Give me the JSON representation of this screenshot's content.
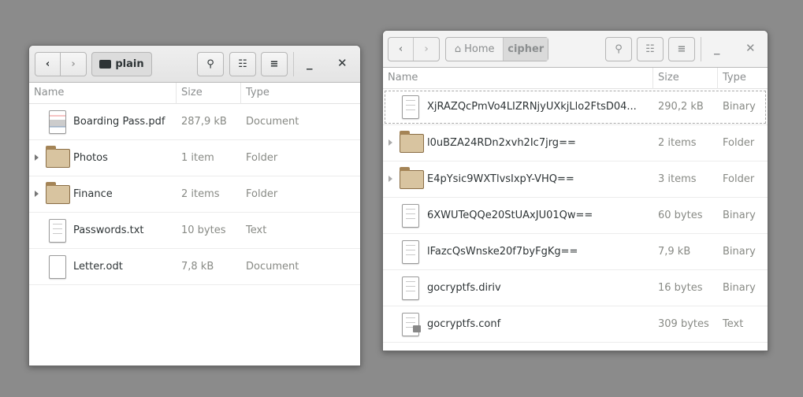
{
  "left": {
    "location": "plain",
    "columns": [
      "Name",
      "Size",
      "Type"
    ],
    "rows": [
      {
        "name": "Boarding Pass.pdf",
        "size": "287,9 kB",
        "type": "Document",
        "icon": "pdf"
      },
      {
        "name": "Photos",
        "size": "1 item",
        "type": "Folder",
        "icon": "folder"
      },
      {
        "name": "Finance",
        "size": "2 items",
        "type": "Folder",
        "icon": "folder"
      },
      {
        "name": "Passwords.txt",
        "size": "10 bytes",
        "type": "Text",
        "icon": "text"
      },
      {
        "name": "Letter.odt",
        "size": "7,8 kB",
        "type": "Document",
        "icon": "blank"
      }
    ]
  },
  "right": {
    "path": [
      "Home",
      "cipher"
    ],
    "columns": [
      "Name",
      "Size",
      "Type"
    ],
    "rows": [
      {
        "name": "XjRAZQcPmVo4LIZRNjyUXkjLlo2FtsD04...",
        "size": "290,2 kB",
        "type": "Binary",
        "icon": "text"
      },
      {
        "name": "l0uBZA24RDn2xvh2Ic7jrg==",
        "size": "2 items",
        "type": "Folder",
        "icon": "folder"
      },
      {
        "name": "E4pYsic9WXTlvsIxpY-VHQ==",
        "size": "3 items",
        "type": "Folder",
        "icon": "folder"
      },
      {
        "name": "6XWUTeQQe20StUAxJU01Qw==",
        "size": "60 bytes",
        "type": "Binary",
        "icon": "text"
      },
      {
        "name": "lFazcQsWnske20f7byFgKg==",
        "size": "7,9 kB",
        "type": "Binary",
        "icon": "text"
      },
      {
        "name": "gocryptfs.diriv",
        "size": "16 bytes",
        "type": "Binary",
        "icon": "text"
      },
      {
        "name": "gocryptfs.conf",
        "size": "309 bytes",
        "type": "Text",
        "icon": "locked-text"
      }
    ]
  }
}
